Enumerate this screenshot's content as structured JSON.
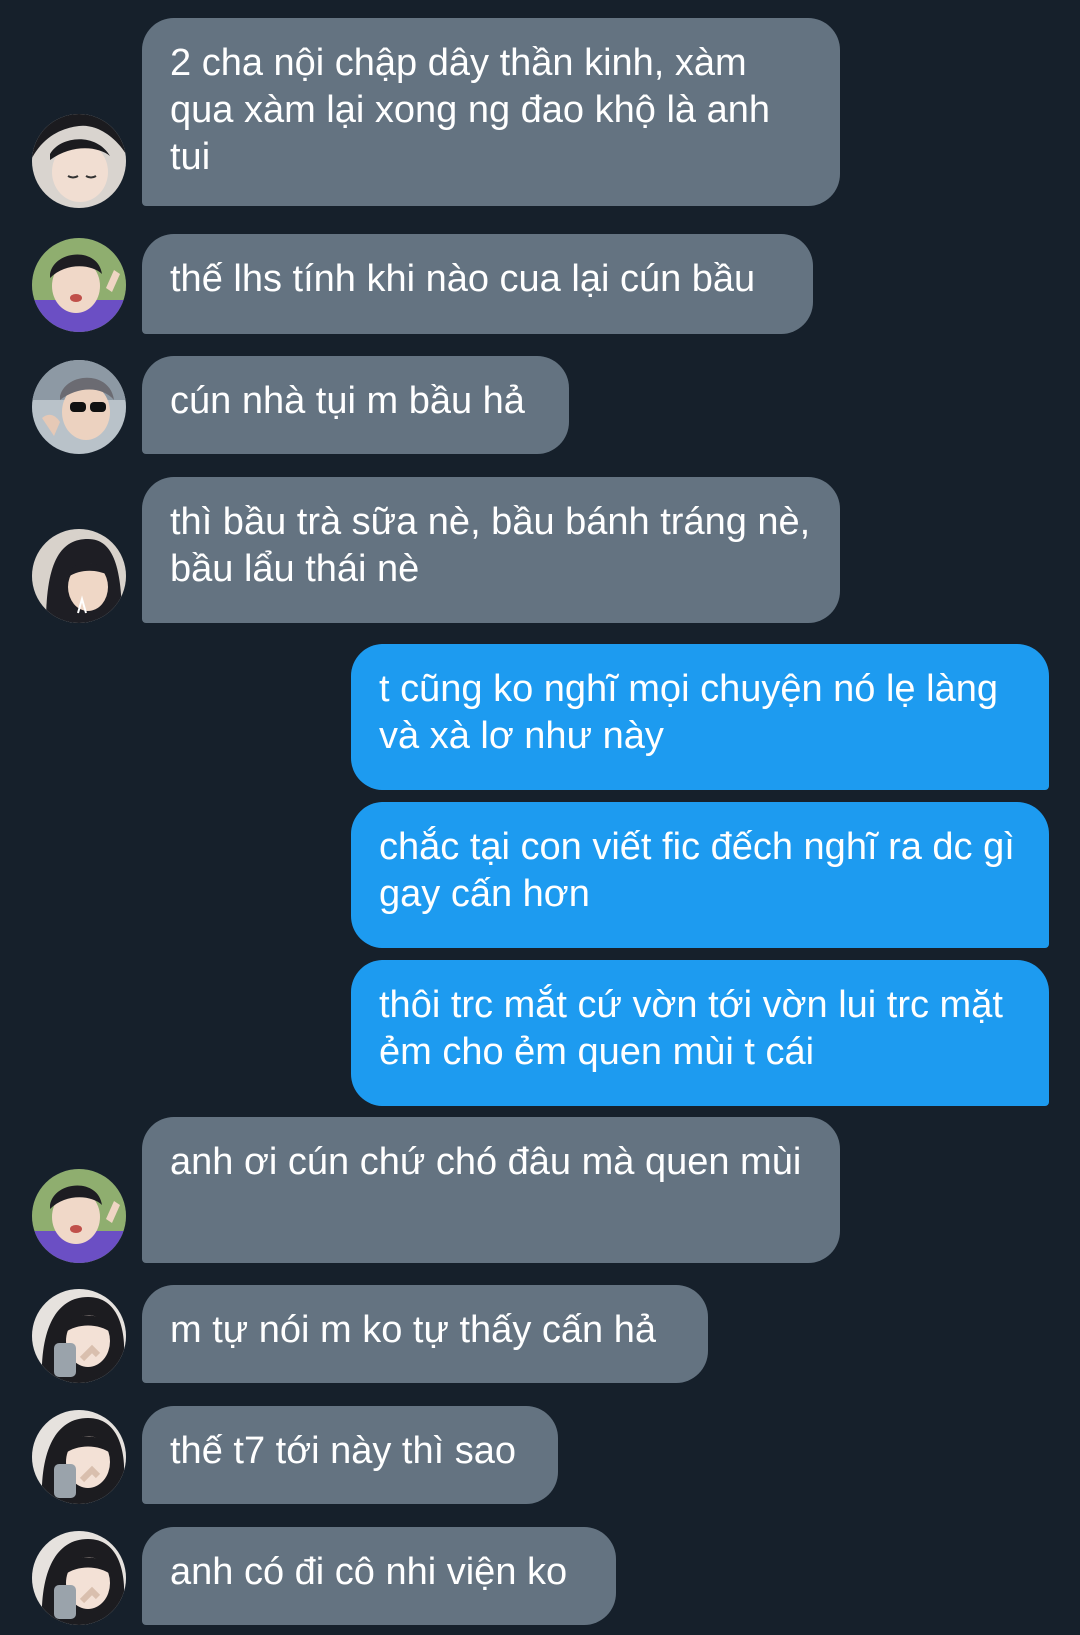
{
  "messages": [
    {
      "dir": "in",
      "text": "2 cha nội chập dây thần kinh, xàm qua xàm lại xong ng đao khộ là anh tui",
      "avatar": "avatar-a"
    },
    {
      "dir": "in",
      "text": "thế lhs tính khi nào cua lại cún bầu",
      "avatar": "avatar-b"
    },
    {
      "dir": "in",
      "text": "cún nhà tụi m bầu hả",
      "avatar": "avatar-c"
    },
    {
      "dir": "in",
      "text": "thì bầu trà sữa nè, bầu bánh tráng nè, bầu lẩu thái nè",
      "avatar": "avatar-d"
    },
    {
      "dir": "out",
      "text": "t cũng ko nghĩ mọi chuyện nó lẹ làng và xà lơ như này"
    },
    {
      "dir": "out",
      "text": "chắc tại con viết fic đếch nghĩ ra dc gì gay cấn hơn"
    },
    {
      "dir": "out",
      "text": "thôi trc mắt cứ vờn tới vờn lui trc mặt ẻm cho ẻm quen mùi t cái"
    },
    {
      "dir": "in",
      "text": "anh ơi cún chứ chó đâu mà quen mùi",
      "avatar": "avatar-b"
    },
    {
      "dir": "in",
      "text": "m tự nói m ko tự thấy cấn hả",
      "avatar": "avatar-e"
    },
    {
      "dir": "in",
      "text": "thế t7 tới này thì sao",
      "avatar": "avatar-e"
    },
    {
      "dir": "in",
      "text": "anh có đi cô nhi viện ko",
      "avatar": "avatar-e"
    }
  ],
  "colors": {
    "background": "#16202b",
    "incoming_bubble": "#647381",
    "outgoing_bubble": "#1d9bf0",
    "text": "#ffffff"
  }
}
